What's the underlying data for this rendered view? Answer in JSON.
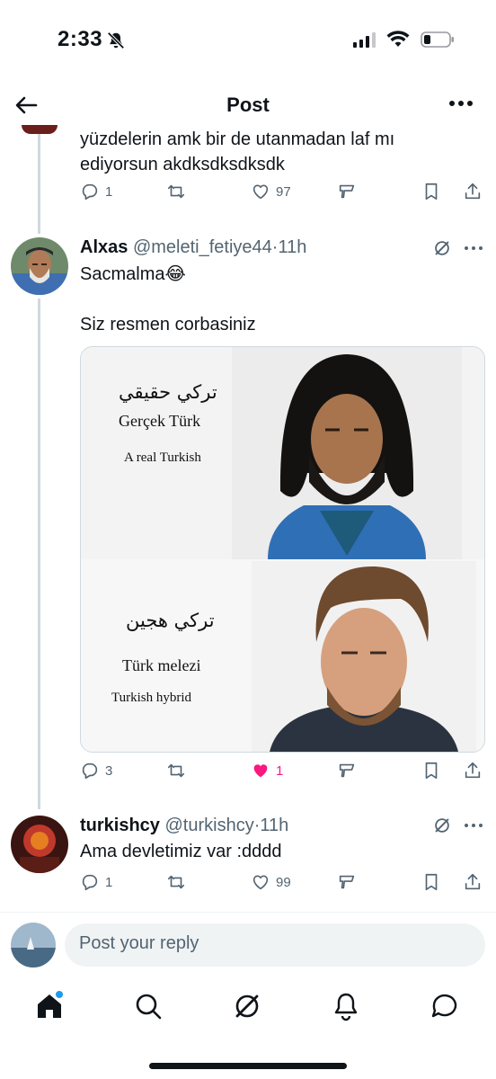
{
  "status_bar": {
    "time": "2:33"
  },
  "header": {
    "title": "Post"
  },
  "parent_post": {
    "text": "yüzdelerin amk bir de utanmadan laf mı ediyorsun akdksdksdksdk",
    "reply_count": "1",
    "like_count": "97"
  },
  "post_alxas": {
    "name": "Alxas",
    "handle": "@meleti_fetiye44",
    "time": "11h",
    "line1": "Sacmalma😂",
    "line2": "Siz resmen corbasiniz",
    "reply_count": "3",
    "like_count": "1",
    "meme": {
      "top_arabic": "تركي حقيقي",
      "top_turkish": "Gerçek Türk",
      "top_english": "A real Turkish",
      "bottom_arabic": "تركي هجين",
      "bottom_turkish": "Türk melezi",
      "bottom_english": "Turkish hybrid"
    }
  },
  "post_turkishcy": {
    "name": "turkishcy",
    "handle": "@turkishcy",
    "time": "11h",
    "text": "Ama devletimiz var :dddd",
    "reply_count": "1",
    "like_count": "99"
  },
  "reply": {
    "placeholder": "Post your reply"
  },
  "colors": {
    "like_active": "#f91880",
    "secondary": "#536471",
    "notification_dot": "#1d9bf0"
  },
  "icons": [
    "back-arrow-icon",
    "more-icon",
    "reply-icon",
    "repost-icon",
    "like-icon",
    "views-icon",
    "bookmark-icon",
    "share-icon",
    "grok-icon",
    "home-icon",
    "search-icon",
    "notifications-icon",
    "messages-icon"
  ]
}
